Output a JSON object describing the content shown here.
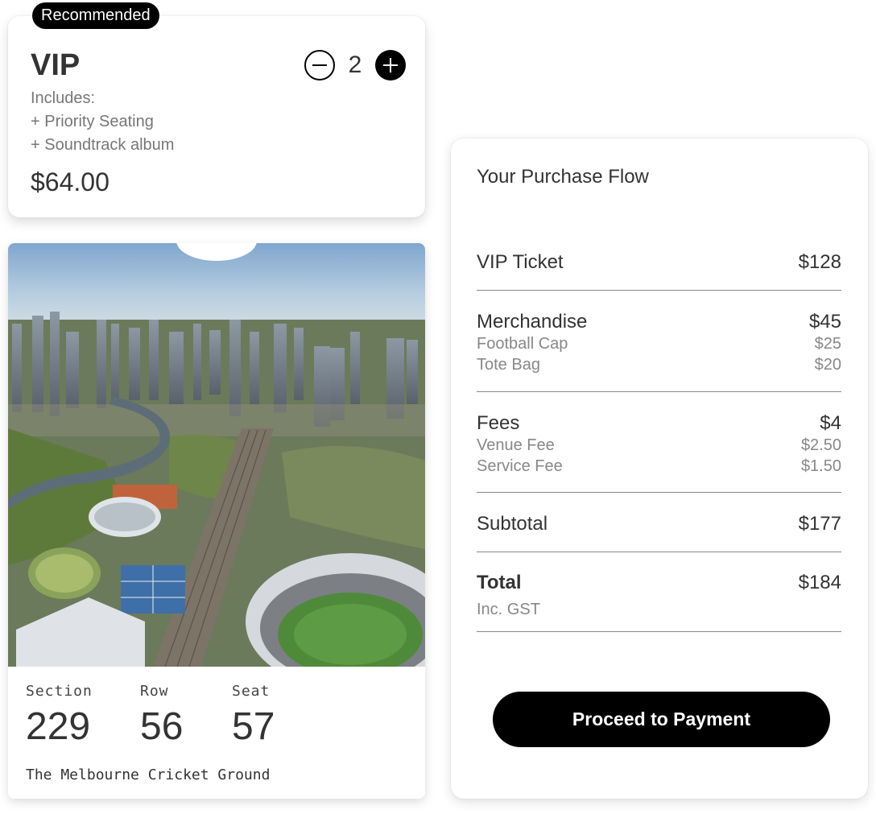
{
  "ticket_option": {
    "badge": "Recommended",
    "name": "VIP",
    "includes_label": "Includes:",
    "includes": [
      "+ Priority Seating",
      "+ Soundtrack album"
    ],
    "price": "$64.00",
    "quantity": "2"
  },
  "ticket": {
    "section_label": "Section",
    "section": "229",
    "row_label": "Row",
    "row": "56",
    "seat_label": "Seat",
    "seat": "57",
    "venue": "The Melbourne Cricket Ground"
  },
  "summary": {
    "title": "Your Purchase Flow",
    "vip": {
      "label": "VIP Ticket",
      "amount": "$128"
    },
    "merch": {
      "label": "Merchandise",
      "amount": "$45",
      "items": [
        {
          "label": "Football Cap",
          "amount": "$25"
        },
        {
          "label": "Tote Bag",
          "amount": "$20"
        }
      ]
    },
    "fees": {
      "label": "Fees",
      "amount": "$4",
      "items": [
        {
          "label": "Venue Fee",
          "amount": "$2.50"
        },
        {
          "label": "Service Fee",
          "amount": "$1.50"
        }
      ]
    },
    "subtotal": {
      "label": "Subtotal",
      "amount": "$177"
    },
    "total": {
      "label": "Total",
      "amount": "$184",
      "note": "Inc. GST"
    },
    "button": "Proceed to Payment"
  },
  "colors": {
    "accent": "#000000",
    "text": "#333333",
    "muted": "#888888"
  }
}
